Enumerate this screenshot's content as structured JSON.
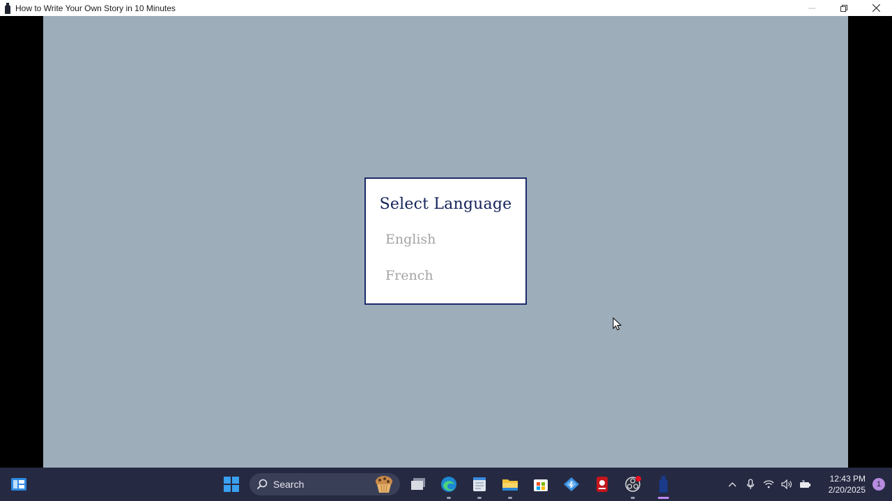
{
  "window": {
    "title": "How to Write Your Own Story in 10 Minutes"
  },
  "dialog": {
    "title": "Select Language",
    "options": [
      "English",
      "French"
    ]
  },
  "taskbar": {
    "search_label": "Search",
    "clock_time": "12:43 PM",
    "clock_date": "2/20/2025",
    "notification_count": "1",
    "pinned": [
      "start-icon",
      "search",
      "task-view-icon",
      "edge-icon",
      "notepad-icon",
      "file-explorer-icon",
      "store-icon",
      "vscode-icon",
      "recorder-icon",
      "obs-icon",
      "game-icon"
    ],
    "tray": [
      "chevron-up-icon",
      "microphone-icon",
      "wifi-icon",
      "speaker-icon",
      "battery-icon"
    ]
  },
  "colors": {
    "canvas_bg": "#9eadba",
    "dialog_border": "#1b2b6b",
    "dialog_title": "#14225a",
    "option_text": "#a3a3a3",
    "taskbar_bg": "#252a42"
  }
}
